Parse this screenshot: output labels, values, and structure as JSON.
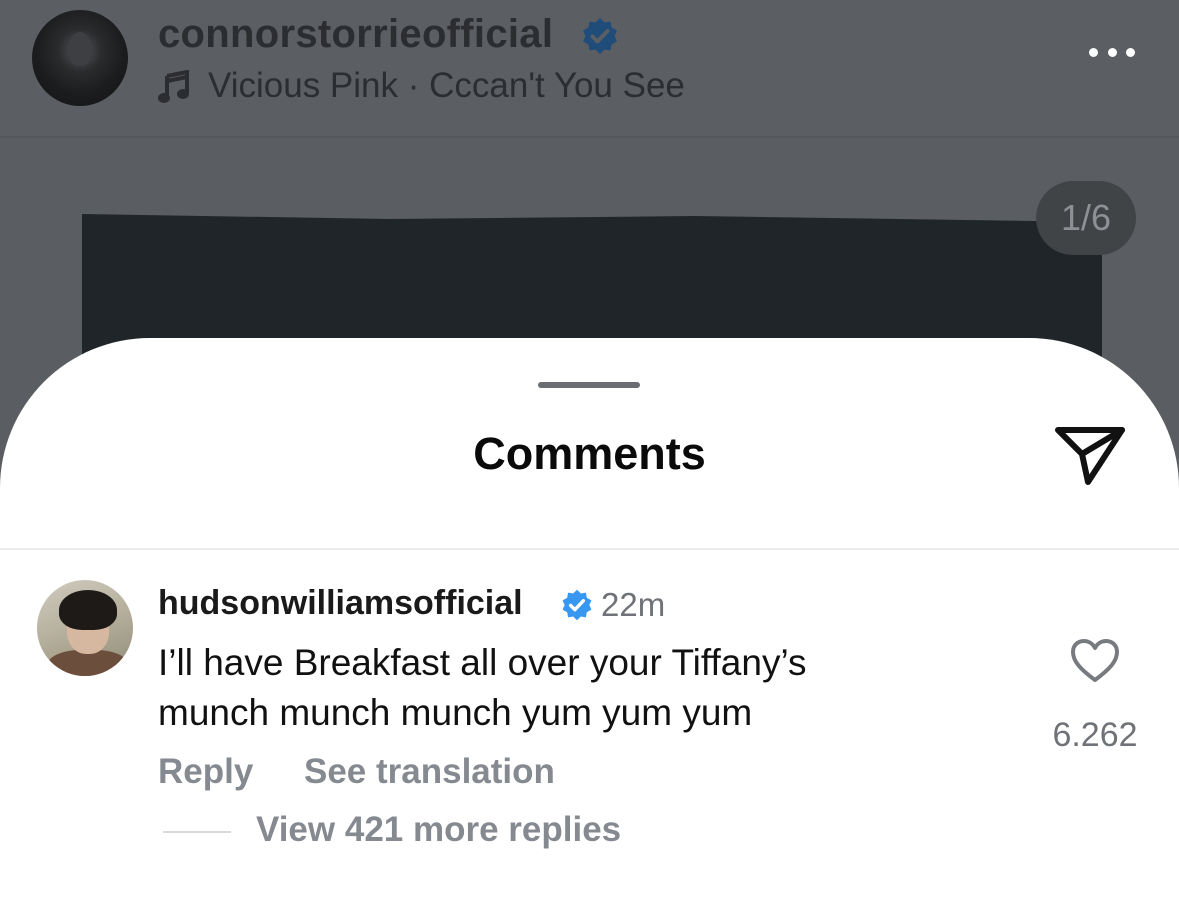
{
  "post": {
    "username": "connorstorrieofficial",
    "music": "Vicious Pink · Cccan't You See",
    "counter": "1/6"
  },
  "sheet": {
    "title": "Comments"
  },
  "comment": {
    "username": "hudsonwilliamsofficial",
    "time": "22m",
    "text_line1": "I’ll have Breakfast all over your Tiffany’s",
    "text_line2": "munch munch munch yum yum yum",
    "like_count": "6.262",
    "reply_label": "Reply",
    "translation_label": "See translation",
    "view_replies_label": "View 421 more replies"
  },
  "colors": {
    "verified": "#3897f0",
    "overlay": "#595c61",
    "secondary_text": "#858990"
  },
  "icons": [
    "verified-badge-icon",
    "music-note-icon",
    "more-options-icon",
    "share-send-icon",
    "heart-icon"
  ]
}
